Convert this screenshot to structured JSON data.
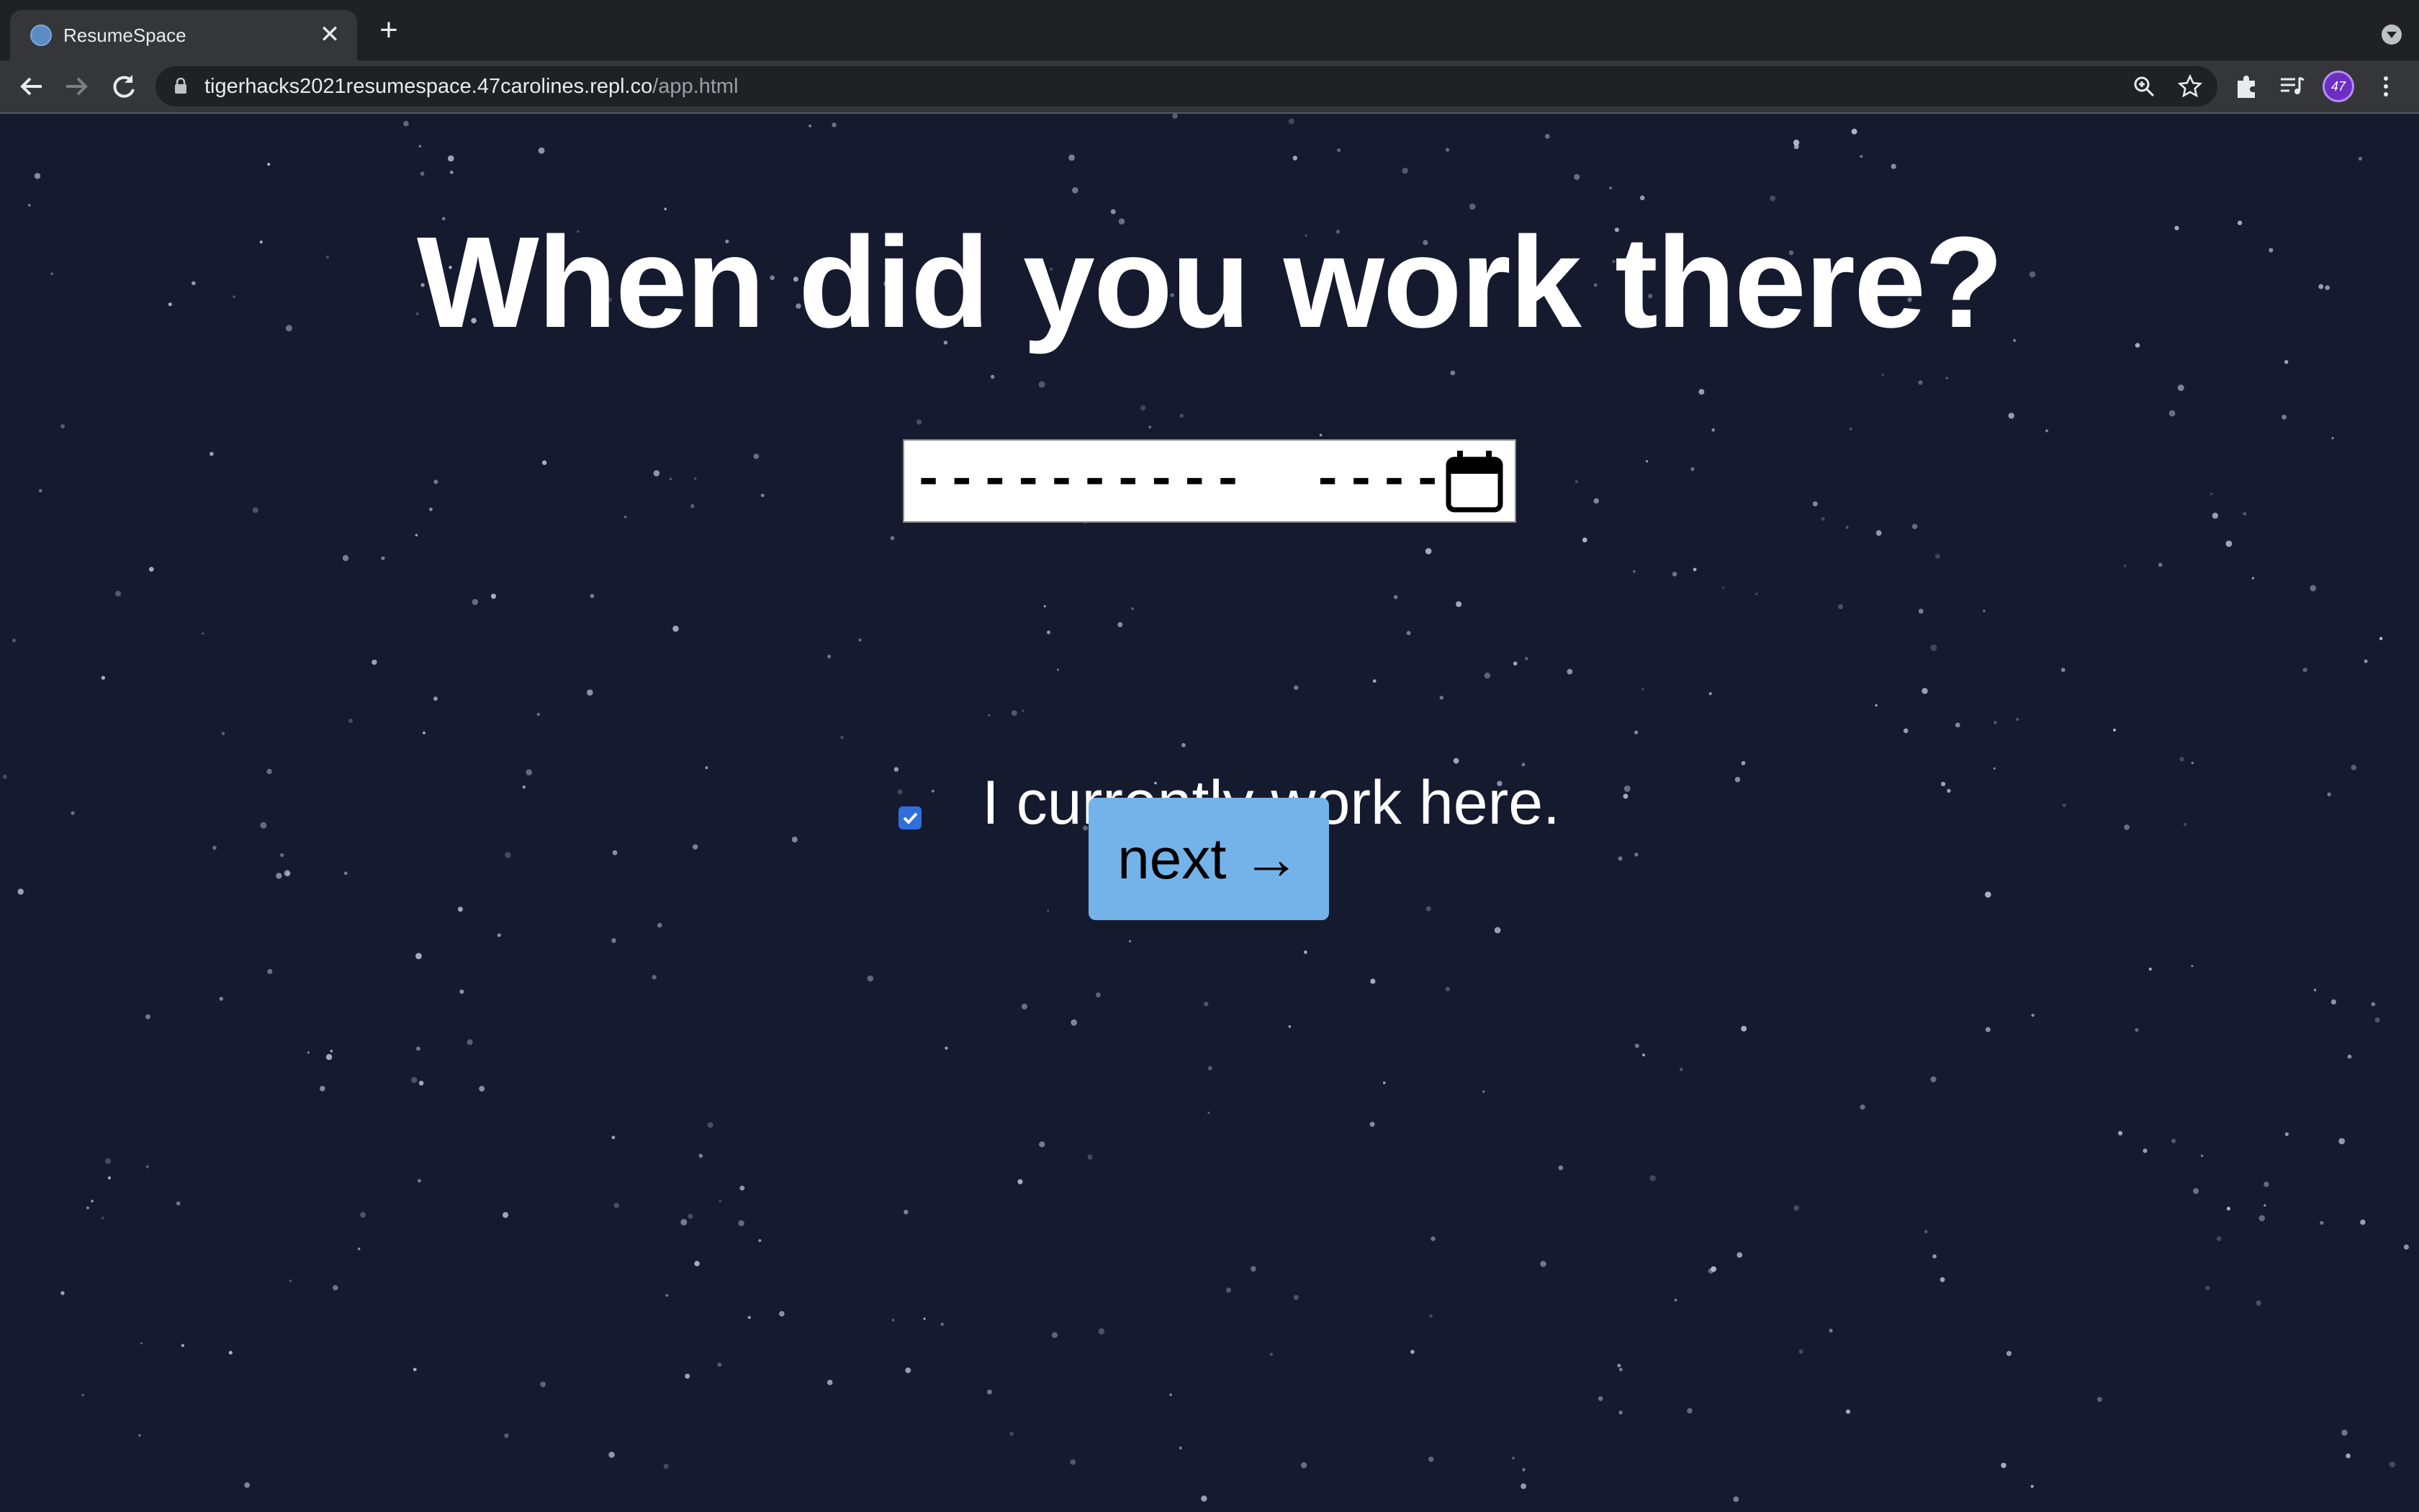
{
  "browser": {
    "tab_title": "ResumeSpace",
    "tab_close_glyph": "✕",
    "new_tab_glyph": "+",
    "url_host": "tigerhacks2021resumespace.47carolines.repl.co",
    "url_path": "/app.html",
    "profile_initials": "47"
  },
  "page": {
    "headline": "When did you work there?",
    "date_mask": "----------  ----",
    "checkbox_label": "I currently work here.",
    "checkbox_checked": true,
    "next_label": "next →"
  },
  "colors": {
    "background": "#161a2e",
    "button": "#74b3e9",
    "checkbox": "#2f6fdb"
  },
  "icons": [
    "favicon-icon",
    "close-icon",
    "plus-icon",
    "back-icon",
    "forward-icon",
    "reload-icon",
    "lock-icon",
    "zoom-icon",
    "star-icon",
    "extensions-icon",
    "media-icon",
    "avatar",
    "menu-icon",
    "calendar-icon",
    "checkbox-check-icon"
  ]
}
